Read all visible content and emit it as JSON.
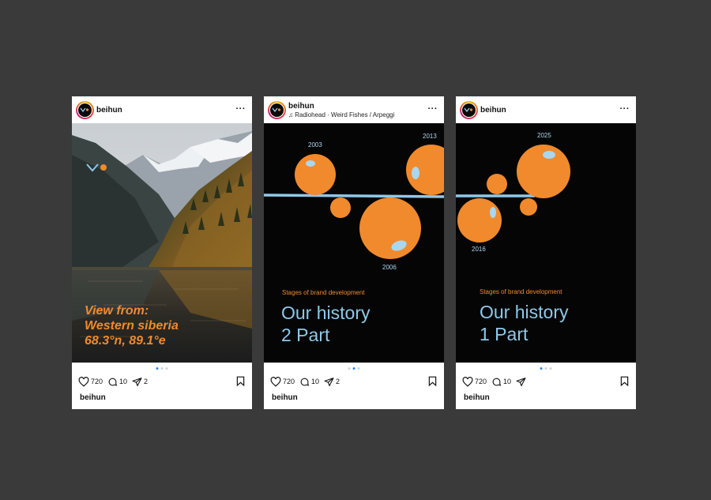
{
  "colors": {
    "background": "#3a3a3a",
    "accent_orange": "#f08a2c",
    "accent_blue": "#8ec9ea",
    "slide_dark": "#050505"
  },
  "icons": {
    "like": "heart-icon",
    "comment": "comment-icon",
    "share": "send-icon",
    "save": "bookmark-icon",
    "more": "more-icon",
    "music": "music-note-icon"
  },
  "posts": [
    {
      "username": "beihun",
      "more": "···",
      "photo_lines": [
        "View from:",
        "Western siberia",
        "68.3°n, 89.1°e"
      ],
      "likes": "720",
      "comments": "10",
      "shares": "2",
      "caption_user": "beihun",
      "carousel_active": 0
    },
    {
      "username": "beihun",
      "subline": "Radiohead · Weird Fishes / Arpeggi",
      "more": "···",
      "stage_label": "Stages of brand development",
      "title_line1": "Our history",
      "title_line2": "2 Part",
      "years": [
        "2003",
        "2013",
        "2006"
      ],
      "likes": "720",
      "comments": "10",
      "shares": "2",
      "caption_user": "beihun",
      "carousel_active": 1
    },
    {
      "username": "beihun",
      "more": "···",
      "stage_label": "Stages of brand development",
      "title_line1": "Our history",
      "title_line2": "1 Part",
      "years": [
        "2025",
        "2016"
      ],
      "likes": "720",
      "comments": "10",
      "caption_user": "beihun",
      "carousel_active": 0
    }
  ]
}
